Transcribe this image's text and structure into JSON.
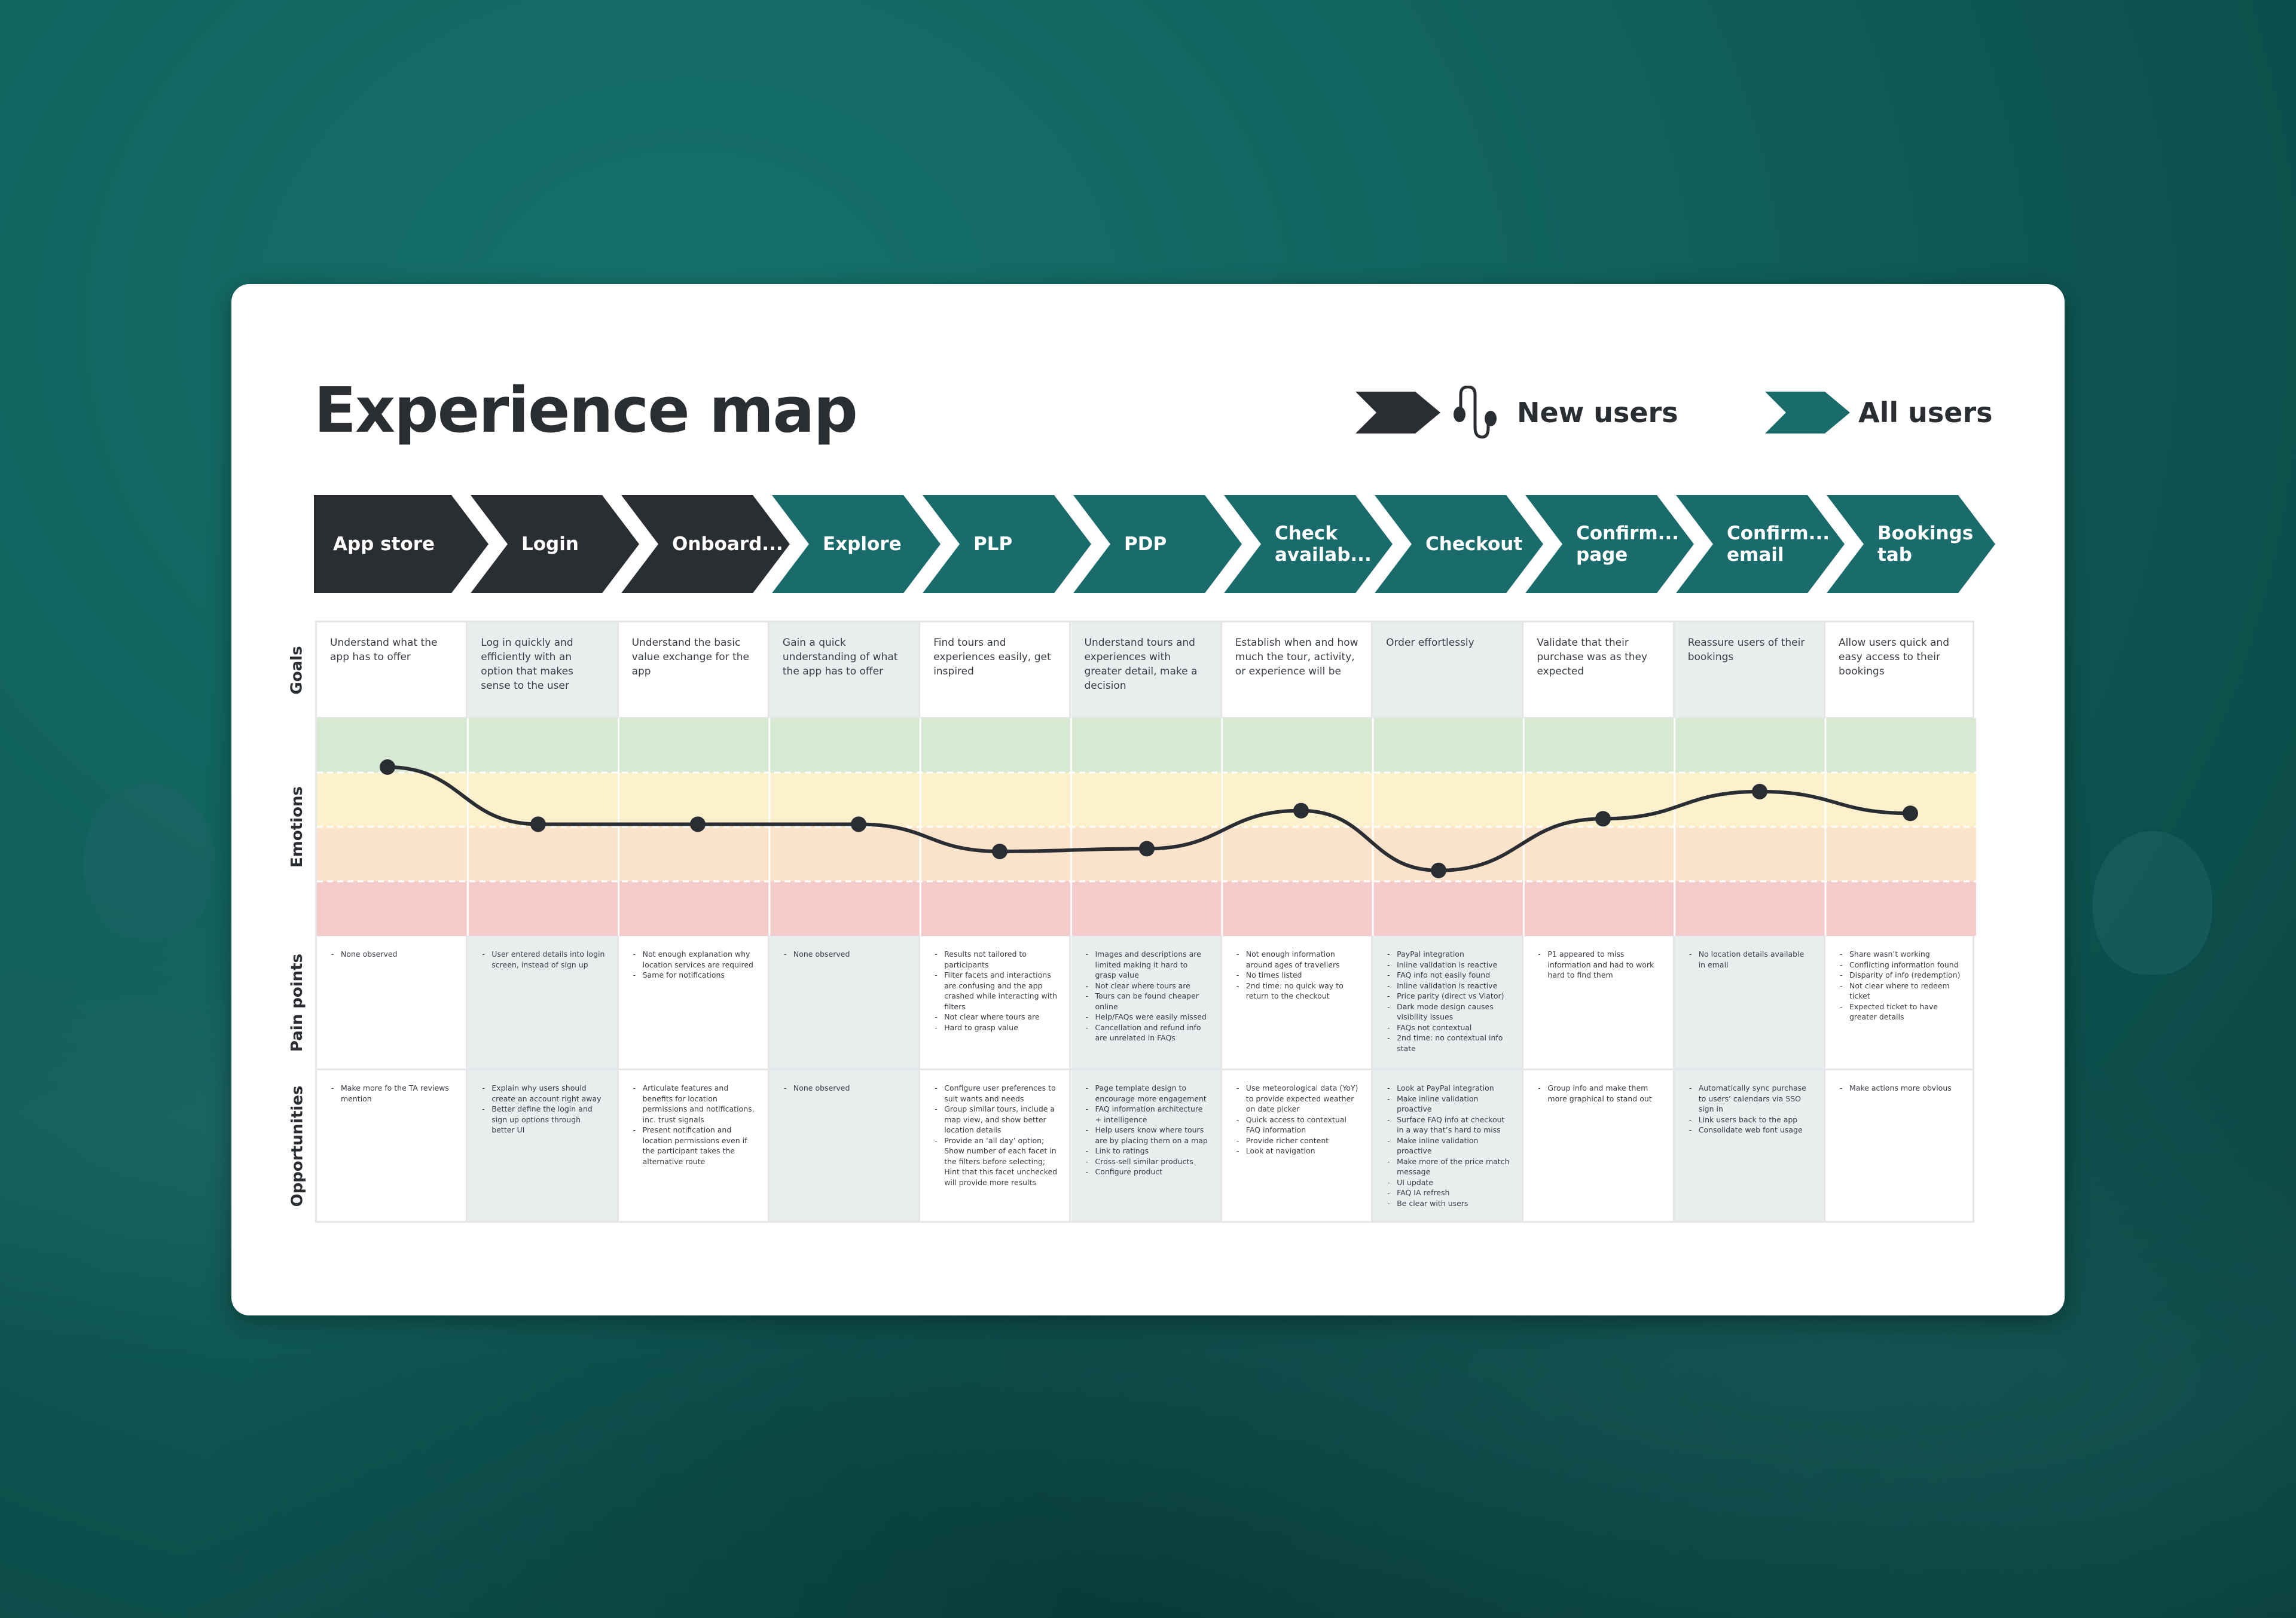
{
  "title": "Experience map",
  "legend": [
    {
      "label": "New users",
      "color": "#2a2e33",
      "icon": "journey-path-icon"
    },
    {
      "label": "All users",
      "color": "#1a6b6b"
    }
  ],
  "colors": {
    "new_users": "#2a2e33",
    "all_users": "#1a6b6b",
    "band_positive": "#d8e9d3",
    "band_neutral": "#fdf0cd",
    "band_mild_negative": "#fbe3cb",
    "band_negative": "#f3cbcb",
    "curve": "#2a2e33"
  },
  "row_labels": {
    "goals": "Goals",
    "emotions": "Emotions",
    "pain_points": "Pain points",
    "opportunities": "Opportunities"
  },
  "stages": [
    {
      "label": "App store",
      "segment": "new_users"
    },
    {
      "label": "Login",
      "segment": "new_users"
    },
    {
      "label": "Onboard...",
      "segment": "new_users"
    },
    {
      "label": "Explore",
      "segment": "all_users"
    },
    {
      "label": "PLP",
      "segment": "all_users"
    },
    {
      "label": "PDP",
      "segment": "all_users"
    },
    {
      "label": "Check\navailab...",
      "segment": "all_users"
    },
    {
      "label": "Checkout",
      "segment": "all_users"
    },
    {
      "label": "Confirm...\npage",
      "segment": "all_users"
    },
    {
      "label": "Confirm...\nemail",
      "segment": "all_users"
    },
    {
      "label": "Bookings\ntab",
      "segment": "all_users"
    }
  ],
  "goals": [
    "Understand what the app has to offer",
    "Log in quickly and efficiently with an option that makes sense to the user",
    "Understand the basic value exchange for the app",
    "Gain a quick understanding of what the app has to offer",
    "Find tours and experiences easily, get inspired",
    "Understand tours and experiences with greater detail, make a decision",
    "Establish when and how much the tour, activity, or experience will be",
    "Order effortlessly",
    "Validate that their purchase was as they expected",
    "Reassure users of their bookings",
    "Allow users quick and easy access to their bookings"
  ],
  "pain_points": [
    [
      "None observed"
    ],
    [
      "User entered details into login screen, instead of sign up"
    ],
    [
      "Not enough explanation why location services are required",
      "Same for notifications"
    ],
    [
      "None observed"
    ],
    [
      "Results not tailored to participants",
      "Filter facets and interactions are confusing and the app crashed while interacting with filters",
      "Not clear where tours are",
      "Hard to grasp value"
    ],
    [
      "Images and descriptions are limited making it hard to grasp value",
      "Not clear where tours are",
      "Tours can be found cheaper online",
      "Help/FAQs were easily missed",
      "Cancellation and refund info are unrelated in FAQs"
    ],
    [
      "Not enough information around ages of travellers",
      "No times listed",
      "2nd time: no quick way to return to the checkout"
    ],
    [
      "PayPal integration",
      "Inline validation is reactive",
      "FAQ info not easily found",
      "Inline validation is reactive",
      "Price parity (direct vs Viator)",
      "Dark mode design causes visibility issues",
      "FAQs not contextual",
      "2nd time: no contextual info state"
    ],
    [
      "P1 appeared to miss information and had to work hard to find them"
    ],
    [
      "No location details available in email"
    ],
    [
      "Share wasn’t working",
      "Conflicting information found",
      "Disparity of info (redemption)",
      "Not clear where to redeem ticket",
      "Expected ticket to have greater details"
    ]
  ],
  "opportunities": [
    [
      "Make more fo the TA reviews mention"
    ],
    [
      "Explain why users should create an account right away",
      "Better define the login and sign up options through better UI"
    ],
    [
      "Articulate features and benefits for location permissions and notifications, inc. trust signals",
      "Present notification and location permissions even if the participant takes the alternative route"
    ],
    [
      "None observed"
    ],
    [
      "Configure user preferences to suit wants and needs",
      "Group similar tours, include a map view, and show better location details",
      "Provide an ‘all day’ option; Show number of each facet in the filters before selecting; Hint that this facet unchecked will provide more results"
    ],
    [
      "Page template design to encourage more engagement",
      "FAQ information architecture + intelligence",
      "Help users know where tours are by placing them on a map",
      "Link to ratings",
      "Cross-sell similar products",
      "Configure product"
    ],
    [
      "Use meteorological data (YoY) to provide expected weather on date picker",
      "Quick access to contextual FAQ information",
      "Provide richer content",
      "Look at navigation"
    ],
    [
      "Look at PayPal integration",
      "Make inline validation proactive",
      "Surface FAQ info at checkout in a way that’s hard to miss",
      "Make inline validation proactive",
      "Make more of the price match message",
      "UI update",
      "FAQ IA refresh",
      "Be clear with users"
    ],
    [
      "Group info and make them more graphical to stand out"
    ],
    [
      "Automatically sync purchase to users’ calendars via SSO sign in",
      "Link users back to the app",
      "Consolidate web font usage"
    ],
    [
      "Make actions more obvious"
    ]
  ],
  "chart_data": {
    "type": "line",
    "title": "Emotions",
    "x": [
      "App store",
      "Login",
      "Onboard...",
      "Explore",
      "PLP",
      "PDP",
      "Check availab...",
      "Checkout",
      "Confirm... page",
      "Confirm... email",
      "Bookings tab"
    ],
    "series": [
      {
        "name": "Emotion",
        "values": [
          3.1,
          2.05,
          2.05,
          2.05,
          1.55,
          1.6,
          2.3,
          1.2,
          2.15,
          2.65,
          2.25
        ]
      }
    ],
    "bands": [
      {
        "name": "positive",
        "range": [
          3,
          4
        ]
      },
      {
        "name": "neutral",
        "range": [
          2,
          3
        ]
      },
      {
        "name": "mild-negative",
        "range": [
          1,
          2
        ]
      },
      {
        "name": "negative",
        "range": [
          0,
          1
        ]
      }
    ],
    "ylim": [
      0,
      4
    ],
    "xlabel": "",
    "ylabel": "Emotions",
    "grid": true,
    "curve": "smooth"
  }
}
